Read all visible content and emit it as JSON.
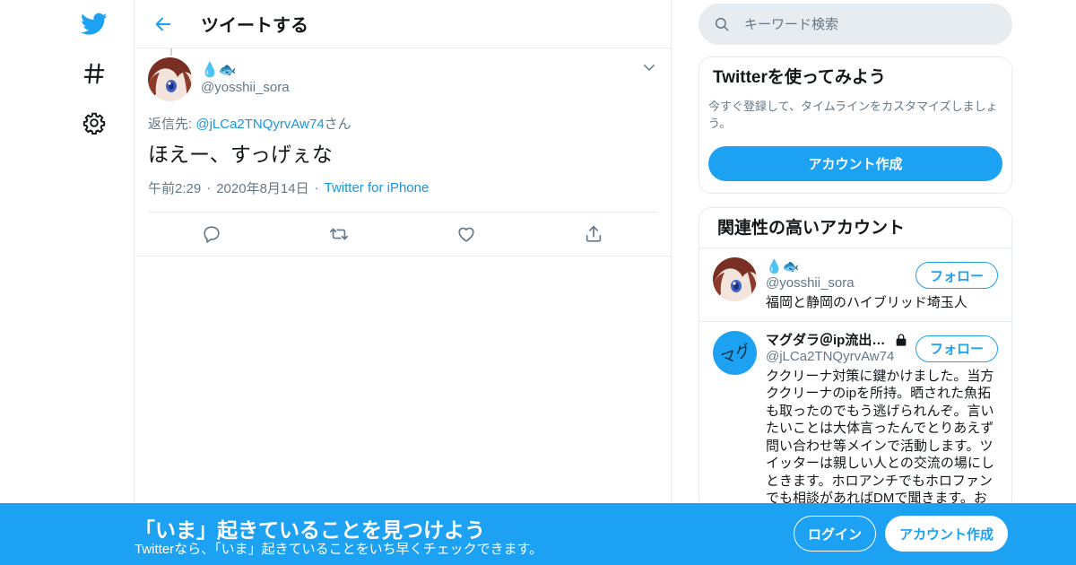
{
  "colors": {
    "brand": "#1da1f2",
    "link": "#1b95e0",
    "muted": "#657786",
    "border": "#e6ecf0"
  },
  "nav": {
    "items": [
      {
        "icon": "twitter-bird-icon"
      },
      {
        "icon": "hashtag-icon"
      },
      {
        "icon": "gear-icon"
      }
    ]
  },
  "header": {
    "title": "ツイートする",
    "back_icon": "arrow-left-icon"
  },
  "tweet": {
    "author": {
      "display_name_emoji": "💧🐟",
      "handle": "@yosshii_sora"
    },
    "reply_prefix": "返信先: ",
    "reply_handle": "@jLCa2TNQyrvAw74",
    "reply_suffix": "さん",
    "text": "ほえー、すっげぇな",
    "time": "午前2:29",
    "date": "2020年8月14日",
    "source": "Twitter for iPhone",
    "actions": [
      "reply-icon",
      "retweet-icon",
      "like-icon",
      "share-icon"
    ]
  },
  "search": {
    "placeholder": "キーワード検索"
  },
  "signup_card": {
    "title": "Twitterを使ってみよう",
    "text": "今すぐ登録して、タイムラインをカスタマイズしましょう。",
    "button": "アカウント作成"
  },
  "related": {
    "title": "関連性の高いアカウント",
    "users": [
      {
        "name": "💧🐟",
        "handle": "@yosshii_sora",
        "bio": "福岡と静岡のハイブリッド埼玉人",
        "follow": "フォロー"
      },
      {
        "name": "マグダラ＠ip流出…",
        "handle": "@jLCa2TNQyrvAw74",
        "bio": "ククリーナ対策に鍵かけました。当方ククリーナのipを所持。晒された魚拓も取ったのでもう逃げられんぞ。言いたいことは大体言ったんでとりあえず問い合わせ等メインで活動します。ツイッターは親しい人との交流の場にしときます。ホロアンチでもホロファンでも相談があればDMで聞きます。お",
        "follow": "フォロー",
        "avatar_text": "マグ",
        "lock_icon": "lock-icon"
      }
    ]
  },
  "bottom_bar": {
    "title": "「いま」起きていることを見つけよう",
    "subtitle": "Twitterなら、「いま」起きていることをいち早くチェックできます。",
    "login": "ログイン",
    "signup": "アカウント作成"
  }
}
